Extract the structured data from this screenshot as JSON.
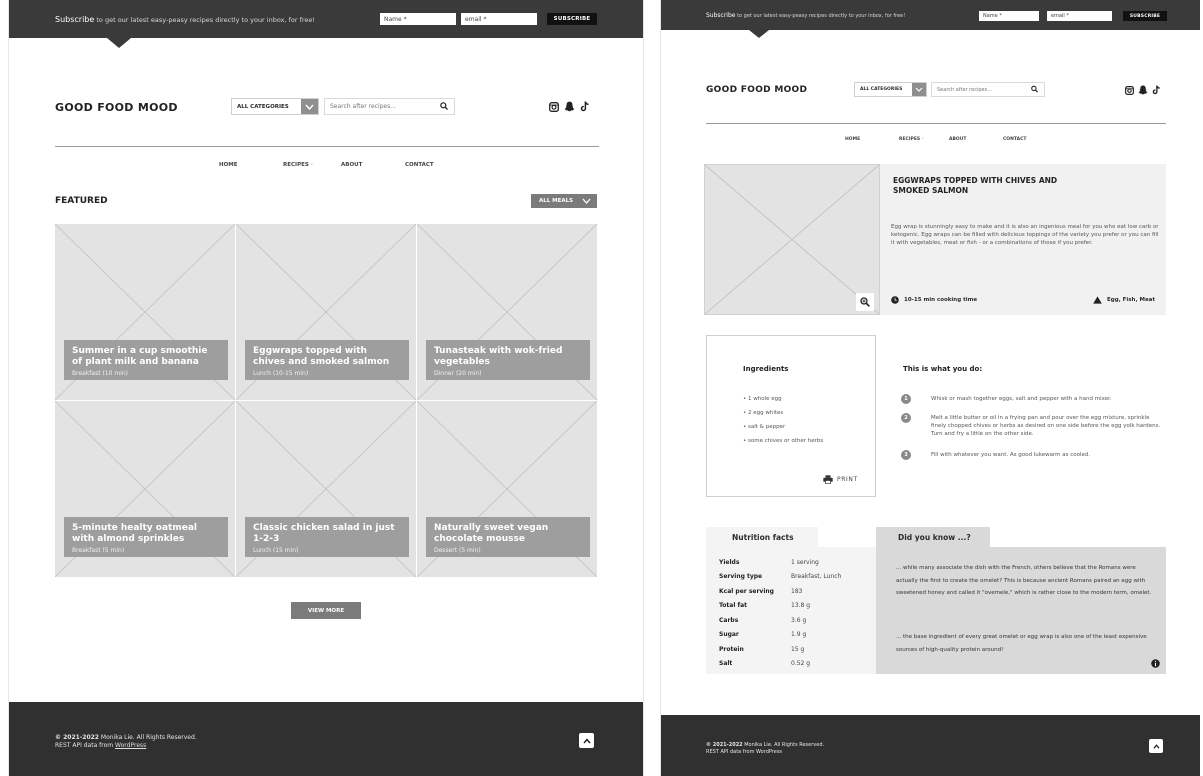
{
  "subscribe": {
    "lead": "Subscribe",
    "text": " to get our latest easy-peasy recipes directly to your inbox, for free!",
    "name_placeholder": "Name *",
    "email_placeholder": "email *",
    "button": "SUBSCRIBE"
  },
  "site": {
    "logo": "GOOD FOOD MOOD"
  },
  "search": {
    "category": "ALL CATEGORIES",
    "placeholder": "Search after recipes..."
  },
  "social_icons": [
    "instagram-icon",
    "snapchat-icon",
    "tiktok-icon"
  ],
  "nav": {
    "items": [
      "HOME",
      "RECIPES",
      "ABOUT",
      "CONTACT"
    ],
    "dropdown_marker": "ᵛ"
  },
  "featured": {
    "title": "FEATURED",
    "filter": "ALL MEALS",
    "cards": [
      {
        "title": "Summer in a cup smoothie of plant milk and banana",
        "meta": "Breakfast (10 min)"
      },
      {
        "title": "Eggwraps topped with chives and smoked salmon",
        "meta": "Lunch (10-15 min)"
      },
      {
        "title": "Tunasteak with wok-fried vegetables",
        "meta": "Dinner (20 min)"
      },
      {
        "title": "5-minute healty oatmeal with almond sprinkles",
        "meta": "Breakfast (5 min)"
      },
      {
        "title": "Classic chicken salad in just 1-2-3",
        "meta": "Lunch (15 min)"
      },
      {
        "title": "Naturally sweet vegan chocolate mousse",
        "meta": "Dessert (5 min)"
      }
    ],
    "view_more": "VIEW MORE"
  },
  "footer": {
    "copyright_bold": "© 2021-2022",
    "copyright_rest": " Monika Lie. All Rights Reserved.",
    "api_text": "REST API data from ",
    "api_link": "WordPress"
  },
  "recipe": {
    "title": "EGGWRAPS TOPPED WITH CHIVES AND SMOKED SALMON",
    "description": "Egg wrap is stunningly easy to make and it is also an ingenious meal for you who eat low carb or ketogenic. Egg wraps can be filled with delicious toppings of the variety you prefer or you can fill it with vegetables, meat or fish - or a combinations of those if you prefer.",
    "cooking_time": "10-15 min cooking time",
    "allergens": "Egg, Fish, Meat",
    "ingredients_title": "Ingredients",
    "ingredients": [
      "• 1 whole egg",
      "• 2 egg whites",
      "• salt & pepper",
      "• some chives or other herbs"
    ],
    "print": "PRINT",
    "steps_title": "This is what you do:",
    "steps": [
      {
        "num": "1",
        "text": "Whisk or mash together eggs, salt and pepper with a hand mixer."
      },
      {
        "num": "2",
        "text": "Melt a little butter or oil in a frying pan and pour over the egg mixture, sprinkle finely chopped chives or herbs as desired on one side before the egg yolk hardens. Turn and fry a little on the other side."
      },
      {
        "num": "3",
        "text": "Fill with whatever you want. As good lukewarm as cooled."
      }
    ],
    "nutrition_title": "Nutrition facts",
    "nutrition": [
      {
        "k": "Yields",
        "v": "1 serving"
      },
      {
        "k": "Serving type",
        "v": "Breakfast, Lunch"
      },
      {
        "k": "Kcal per serving",
        "v": "183"
      },
      {
        "k": "Total fat",
        "v": "13.8 g"
      },
      {
        "k": "Carbs",
        "v": "3.6 g"
      },
      {
        "k": "Sugar",
        "v": "1.9 g"
      },
      {
        "k": "Protein",
        "v": "15 g"
      },
      {
        "k": "Salt",
        "v": "0.52 g"
      }
    ],
    "didyouknow_title": "Did you know ...?",
    "didyouknow_1": "... while many associate the dish with the French, others believe that the Romans were actually the first to create the omelet? This is because ancient Romans paired an egg with sweetened honey and called it \"ovemele,\" which is rather close to the modern term, omelet.",
    "didyouknow_2": "... the base ingredient of every great omelet or egg wrap is also one of the least expensive sources of high-quality protein around!"
  },
  "colors": {
    "dark_bar": "#3a3a3a",
    "footer": "#303030",
    "card_label": "#9e9e9e",
    "placeholder": "#e3e3e3",
    "button": "#7b7b7b"
  }
}
